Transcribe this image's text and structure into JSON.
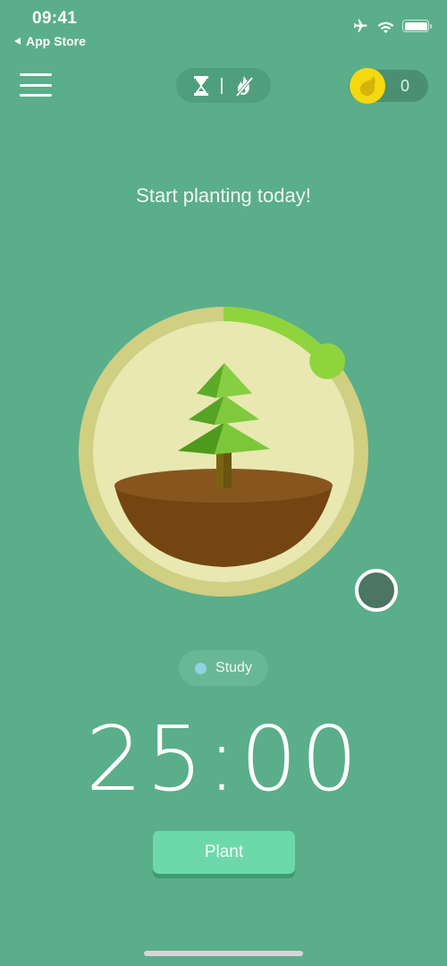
{
  "status_bar": {
    "time": "09:41",
    "back_label": "App Store",
    "icons": [
      "airplane-mode-icon",
      "wifi-icon",
      "battery-icon"
    ]
  },
  "top_bar": {
    "menu_icon": "hamburger-menu-icon",
    "mode_toggle": {
      "icons": [
        "hourglass-icon",
        "no-fire-icon"
      ],
      "active": "timer"
    },
    "coins": {
      "icon": "seed-coin-icon",
      "count": "0"
    }
  },
  "headline": "Start planting today!",
  "tree_ring": {
    "progress_fraction": 0.136,
    "colors": {
      "track": "#d0cf82",
      "face": "#e8e8b0",
      "progress": "#8fd43c",
      "soil_top": "#87561f",
      "soil_body": "#744510",
      "trunk": "#7a6412",
      "foliage_light": "#7cc63a",
      "foliage_dark": "#4e9a1c"
    },
    "tree_type": "pine-tree"
  },
  "tree_toggle_button": "tree-species-toggle",
  "tag": {
    "label": "Study",
    "color": "#8fd3df"
  },
  "timer": {
    "display": "25:00"
  },
  "plant_button": {
    "label": "Plant"
  },
  "colors": {
    "background": "#5aae8a",
    "accent": "#6dd9a9",
    "coin": "#f5d90f"
  }
}
